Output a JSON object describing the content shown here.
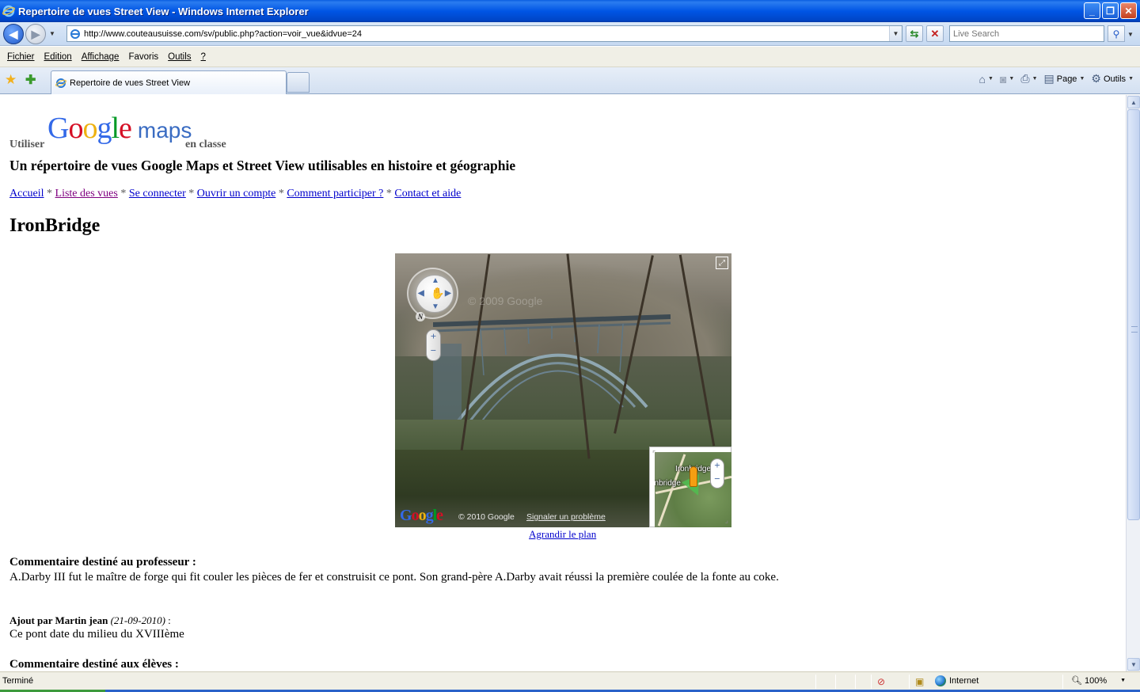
{
  "window": {
    "title": "Repertoire de vues Street View - Windows Internet Explorer",
    "buttons": {
      "minimize": "_",
      "maximize": "❐",
      "close": "✕"
    }
  },
  "addressbar": {
    "url": "http://www.couteausuisse.com/sv/public.php?action=voir_vue&idvue=24",
    "search_placeholder": "Live Search"
  },
  "menu": {
    "items": [
      {
        "label": "Fichier",
        "accel": "F"
      },
      {
        "label": "Edition",
        "accel": "E"
      },
      {
        "label": "Affichage",
        "accel": "A"
      },
      {
        "label": "Favoris",
        "accel": "v"
      },
      {
        "label": "Outils",
        "accel": "O"
      },
      {
        "label": "?",
        "accel": "?"
      }
    ]
  },
  "tabs": {
    "active_title": "Repertoire de vues Street View"
  },
  "commandbar": {
    "page_label": "Page",
    "tools_label": "Outils"
  },
  "page": {
    "logo_left": "Utiliser",
    "logo_google": "Google",
    "logo_maps": "maps",
    "logo_right": "en classe",
    "subtitle": "Un répertoire de vues Google Maps et Street View utilisables en histoire et géographie",
    "nav": {
      "items": [
        "Accueil",
        "Liste des vues",
        "Se connecter",
        "Ouvrir un compte",
        "Comment participer ?",
        "Contact et aide"
      ],
      "separator": "*"
    },
    "title": "IronBridge",
    "streetview": {
      "watermark": "© 2009 Google",
      "copyright": "© 2010 Google",
      "report": "Signaler un problème",
      "minimap_label_1": "Ironbridge",
      "minimap_label_2": "onbridge",
      "compass_north": "N",
      "google_logo": "Google"
    },
    "enlarge_link": "Agrandir le plan",
    "teacher_comment_heading": "Commentaire destiné au professeur :",
    "teacher_comment_text": "A.Darby III fut le maître de forge qui fit couler les pièces de fer et construisit ce pont. Son grand-père A.Darby avait réussi la première coulée de la fonte au coke.",
    "addition": {
      "prefix": "Ajout par Martin jean",
      "date": "(21-09-2010)",
      "suffix": " :",
      "text": "Ce pont date du milieu du XVIIIème"
    },
    "students_comment_heading": "Commentaire destiné aux élèves :"
  },
  "statusbar": {
    "status": "Terminé",
    "zone": "Internet",
    "zoom": "100%"
  },
  "colors": {
    "link": "#0000cc",
    "visited_link": "#800080",
    "titlebar": "#0055e5"
  }
}
